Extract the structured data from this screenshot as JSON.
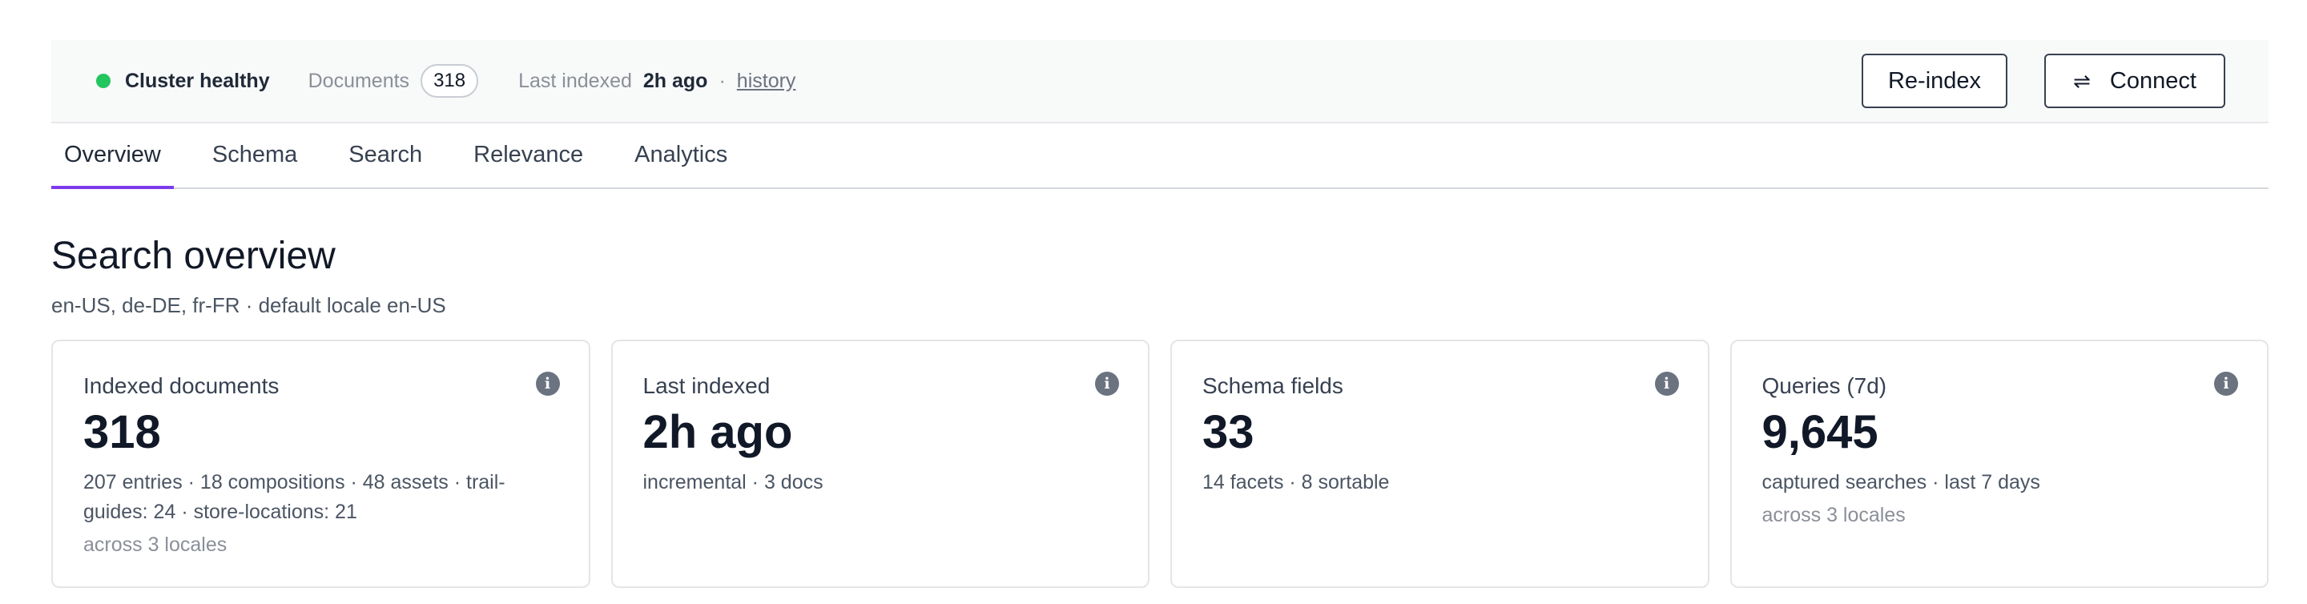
{
  "status": {
    "health_label": "Cluster healthy",
    "health_color": "#22c55e",
    "documents_label": "Documents",
    "documents_count": "318",
    "last_indexed_label": "Last indexed",
    "last_indexed_value": "2h ago",
    "separator": "·",
    "history_link": "history"
  },
  "actions": {
    "reindex_label": "Re-index",
    "connect_label": "Connect",
    "connect_icon": "swap-arrows-icon"
  },
  "tabs": [
    {
      "label": "Overview",
      "active": true
    },
    {
      "label": "Schema",
      "active": false
    },
    {
      "label": "Search",
      "active": false
    },
    {
      "label": "Relevance",
      "active": false
    },
    {
      "label": "Analytics",
      "active": false
    }
  ],
  "accent_color": "#7c3aed",
  "page": {
    "title": "Search overview",
    "subtitle": "en-US, de-DE, fr-FR · default locale en-US"
  },
  "cards": [
    {
      "label": "Indexed documents",
      "value": "318",
      "detail": "207 entries · 18 compositions · 48 assets · trail-guides: 24 · store-locations: 21",
      "foot": "across 3 locales",
      "icon": "info-icon"
    },
    {
      "label": "Last indexed",
      "value": "2h ago",
      "detail": "incremental · 3 docs",
      "foot": "",
      "icon": "info-icon"
    },
    {
      "label": "Schema fields",
      "value": "33",
      "detail": "14 facets · 8 sortable",
      "foot": "",
      "icon": "info-icon"
    },
    {
      "label": "Queries (7d)",
      "value": "9,645",
      "detail": "captured searches · last 7 days",
      "foot": "across 3 locales",
      "icon": "info-icon"
    }
  ]
}
